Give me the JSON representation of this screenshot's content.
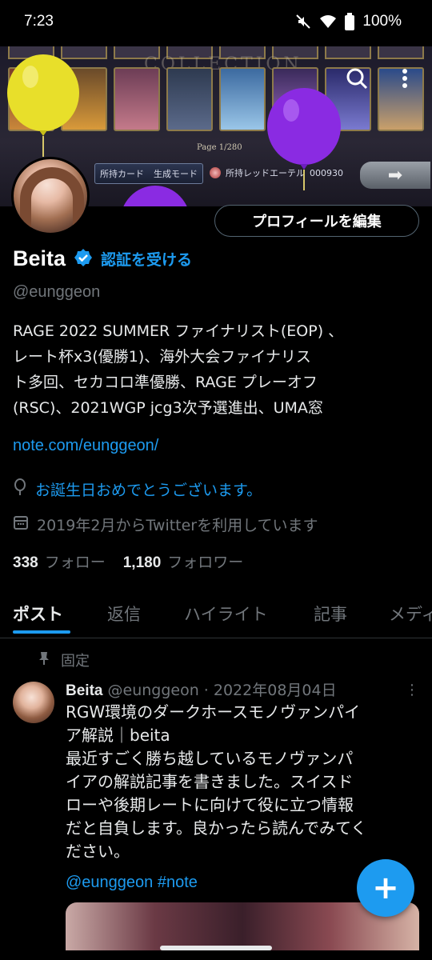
{
  "status_bar": {
    "time": "7:23",
    "battery": "100%"
  },
  "banner": {
    "collection_text": "COLLECTION",
    "page_text": "Page 1/280",
    "owned_card_label": "所持カード",
    "create_mode_label": "生成モード",
    "red_ether_label": "所持レッドエーテル",
    "red_ether_value": "000930"
  },
  "profile": {
    "name": "Beita",
    "verify_link": "認証を受ける",
    "handle": "@eunggeon",
    "edit_button": "プロフィールを編集",
    "bio_lines": [
      "RAGE 2022 SUMMER ファイナリスト(EOP) 、",
      "レート杯x3(優勝1)、海外大会ファイナリス",
      "ト多回、セカコロ準優勝、RAGE プレーオフ",
      "(RSC)、2021WGP jcg3次予選進出、UMA窓"
    ],
    "bio_link": "note.com/eunggeon/",
    "birthday": "お誕生日おめでとうございます。",
    "joined": "2019年2月からTwitterを利用しています",
    "following_count": "338",
    "following_label": "フォロー",
    "followers_count": "1,180",
    "followers_label": "フォロワー"
  },
  "tabs": [
    "ポスト",
    "返信",
    "ハイライト",
    "記事",
    "メディ"
  ],
  "pinned_post": {
    "pinned_label": "固定",
    "author": "Beita",
    "meta": " @eunggeon · 2022年08月04日",
    "lines": [
      "RGW環境のダークホースモノヴァンパイ",
      "ア解説｜beita",
      "最近すごく勝ち越しているモノヴァンパ",
      "イアの解説記事を書きました。スイスド",
      "ローや後期レートに向けて役に立つ情報",
      "だと自負します。良かったら読んでみてく",
      "ださい。"
    ],
    "tags": "@eunggeon #note"
  },
  "colors": {
    "accent": "#1d9bf0",
    "background": "#000000",
    "muted": "#71767b",
    "balloon_yellow": "#e8df2a",
    "balloon_purple": "#8a2be2"
  },
  "icons": [
    "mute-icon",
    "wifi-icon",
    "battery-icon",
    "search-icon",
    "more-vertical-icon",
    "verified-badge-icon",
    "balloon-icon",
    "calendar-icon",
    "pin-icon",
    "compose-plus-icon"
  ]
}
